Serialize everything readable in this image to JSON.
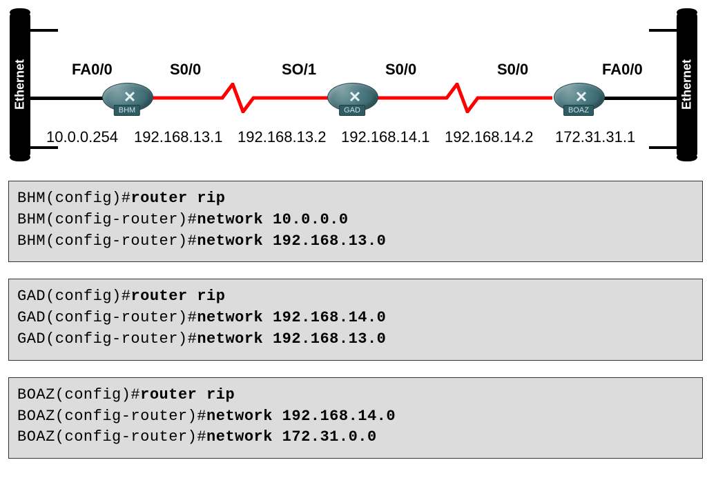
{
  "ethernet_label": "Ethernet",
  "routers": {
    "bhm": "BHM",
    "gad": "GAD",
    "boaz": "BOAZ"
  },
  "interfaces": {
    "bhm_fa": "FA0/0",
    "bhm_s0": "S0/0",
    "gad_s1": "SO/1",
    "gad_s0": "S0/0",
    "boaz_s0": "S0/0",
    "boaz_fa": "FA0/0"
  },
  "ips": {
    "bhm_fa": "10.0.0.254",
    "bhm_s0": "192.168.13.1",
    "gad_s1": "192.168.13.2",
    "gad_s0": "192.168.14.1",
    "boaz_s0": "192.168.14.2",
    "boaz_fa": "172.31.31.1"
  },
  "cfg": {
    "bhm": {
      "p1": "BHM(config)#",
      "c1": "router rip",
      "p2": "BHM(config-router)#",
      "c2": "network 10.0.0.0",
      "p3": "BHM(config-router)#",
      "c3": "network 192.168.13.0"
    },
    "gad": {
      "p1": "GAD(config)#",
      "c1": "router rip",
      "p2": "GAD(config-router)#",
      "c2": "network 192.168.14.0",
      "p3": "GAD(config-router)#",
      "c3": "network 192.168.13.0"
    },
    "boaz": {
      "p1": "BOAZ(config)#",
      "c1": "router rip",
      "p2": "BOAZ(config-router)#",
      "c2": "network 192.168.14.0",
      "p3": "BOAZ(config-router)#",
      "c3": "network 172.31.0.0"
    }
  }
}
